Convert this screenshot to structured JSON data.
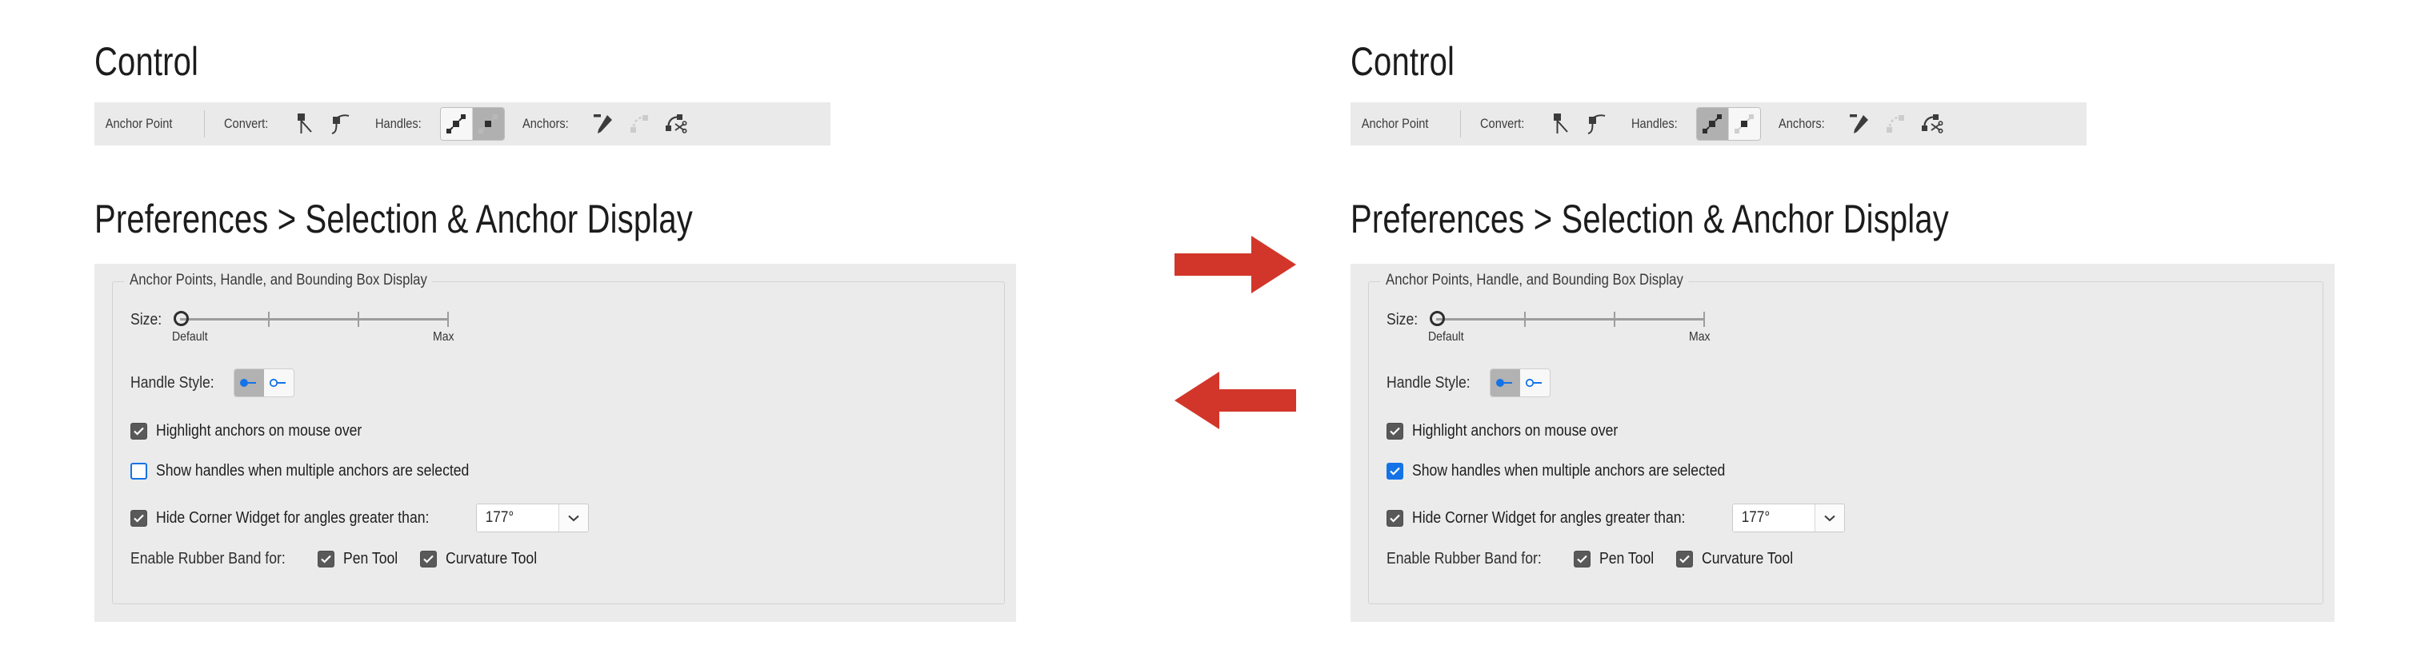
{
  "accent_colors": {
    "arrow_red": "#d2362a",
    "checkbox_blue": "#1473e6",
    "checkbox_gray": "#595959",
    "panel_bg": "#ebebeb",
    "toolbar_bg": "#eaeaea",
    "segment_active": "#b0b0b0"
  },
  "panels": [
    {
      "id": "before",
      "control": {
        "heading": "Control",
        "toolbar": {
          "title": "Anchor Point",
          "convert": {
            "label": "Convert:",
            "buttons": [
              {
                "name": "convert-to-corner-icon",
                "enabled": true
              },
              {
                "name": "convert-to-smooth-icon",
                "enabled": true
              }
            ]
          },
          "handles": {
            "label": "Handles:",
            "buttons": [
              {
                "name": "show-handles-single-icon",
                "selected": false
              },
              {
                "name": "show-handles-multiple-icon",
                "selected": true
              }
            ]
          },
          "anchors": {
            "label": "Anchors:",
            "buttons": [
              {
                "name": "add-anchor-pen-icon",
                "enabled": true
              },
              {
                "name": "remove-anchor-icon",
                "enabled": false
              },
              {
                "name": "cut-path-scissors-icon",
                "enabled": true
              }
            ]
          }
        }
      },
      "preferences": {
        "heading": "Preferences > Selection & Anchor Display",
        "group_title": "Anchor Points, Handle, and Bounding Box Display",
        "size": {
          "label": "Size:",
          "min_caption": "Default",
          "max_caption": "Max",
          "value": 0
        },
        "handle_style": {
          "label": "Handle Style:",
          "options": [
            {
              "name": "handle-style-solid-icon",
              "selected": true
            },
            {
              "name": "handle-style-hollow-icon",
              "selected": false
            }
          ]
        },
        "checkboxes": [
          {
            "label": "Highlight anchors on mouse over",
            "checked": true,
            "style": "gray"
          },
          {
            "label": "Show handles when multiple anchors are selected",
            "checked": false,
            "style": "empty"
          },
          {
            "label": "Hide Corner Widget for angles greater than:",
            "checked": true,
            "style": "gray"
          }
        ],
        "angle_dropdown": {
          "value": "177°"
        },
        "rubber_band": {
          "label": "Enable Rubber Band for:",
          "items": [
            {
              "label": "Pen Tool",
              "checked": true,
              "style": "gray"
            },
            {
              "label": "Curvature Tool",
              "checked": true,
              "style": "gray"
            }
          ]
        }
      }
    },
    {
      "id": "after",
      "control": {
        "heading": "Control",
        "toolbar": {
          "title": "Anchor Point",
          "convert": {
            "label": "Convert:",
            "buttons": [
              {
                "name": "convert-to-corner-icon",
                "enabled": true
              },
              {
                "name": "convert-to-smooth-icon",
                "enabled": true
              }
            ]
          },
          "handles": {
            "label": "Handles:",
            "buttons": [
              {
                "name": "show-handles-single-icon",
                "selected": true
              },
              {
                "name": "show-handles-multiple-icon",
                "selected": false
              }
            ]
          },
          "anchors": {
            "label": "Anchors:",
            "buttons": [
              {
                "name": "add-anchor-pen-icon",
                "enabled": true
              },
              {
                "name": "remove-anchor-icon",
                "enabled": false
              },
              {
                "name": "cut-path-scissors-icon",
                "enabled": true
              }
            ]
          }
        }
      },
      "preferences": {
        "heading": "Preferences > Selection & Anchor Display",
        "group_title": "Anchor Points, Handle, and Bounding Box Display",
        "size": {
          "label": "Size:",
          "min_caption": "Default",
          "max_caption": "Max",
          "value": 0
        },
        "handle_style": {
          "label": "Handle Style:",
          "options": [
            {
              "name": "handle-style-solid-icon",
              "selected": true
            },
            {
              "name": "handle-style-hollow-icon",
              "selected": false
            }
          ]
        },
        "checkboxes": [
          {
            "label": "Highlight anchors on mouse over",
            "checked": true,
            "style": "gray"
          },
          {
            "label": "Show handles when multiple anchors are selected",
            "checked": true,
            "style": "blue"
          },
          {
            "label": "Hide Corner Widget for angles greater than:",
            "checked": true,
            "style": "gray"
          }
        ],
        "angle_dropdown": {
          "value": "177°"
        },
        "rubber_band": {
          "label": "Enable Rubber Band for:",
          "items": [
            {
              "label": "Pen Tool",
              "checked": true,
              "style": "gray"
            },
            {
              "label": "Curvature Tool",
              "checked": true,
              "style": "gray"
            }
          ]
        }
      }
    }
  ],
  "arrows": [
    {
      "name": "arrow-right-icon",
      "direction": "right"
    },
    {
      "name": "arrow-left-icon",
      "direction": "left"
    }
  ]
}
